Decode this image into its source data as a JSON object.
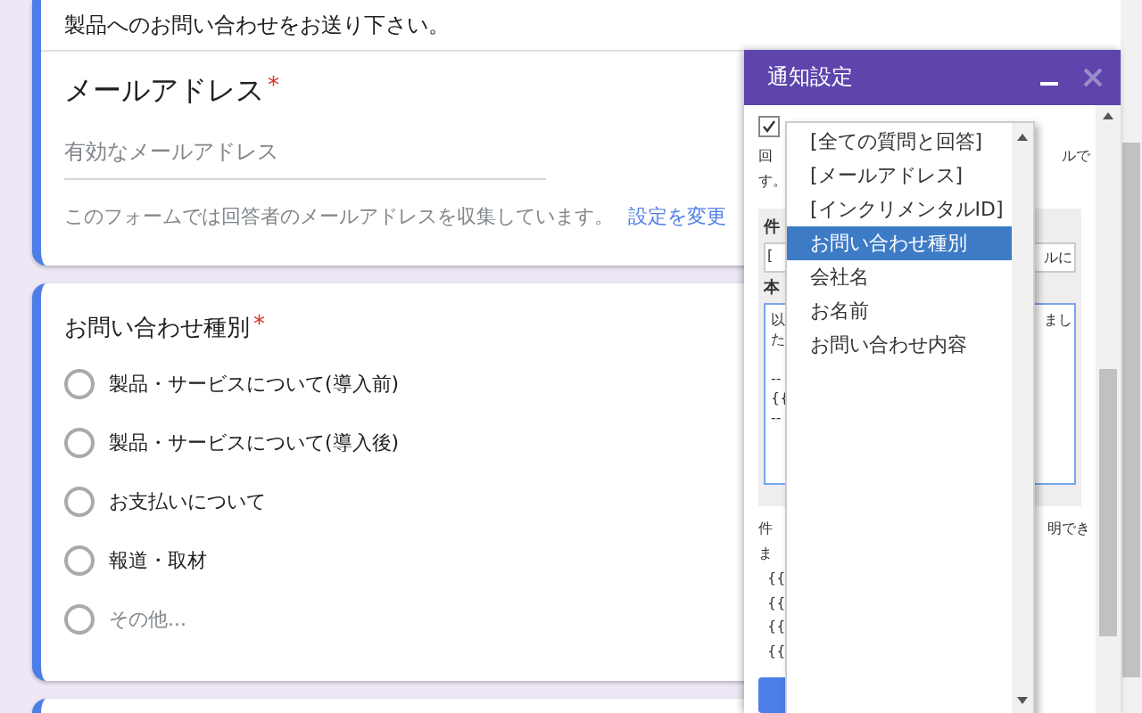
{
  "form": {
    "description": "製品へのお問い合わせをお送り下さい。",
    "email_question": {
      "title": "メールアドレス",
      "required_mark": "*",
      "placeholder": "有効なメールアドレス",
      "note": "このフォームでは回答者のメールアドレスを収集しています。",
      "link": "設定を変更"
    },
    "choice_question": {
      "title": "お問い合わせ種別",
      "required_mark": "*",
      "options": [
        {
          "label": "製品・サービスについて(導入前)",
          "kind": "option",
          "selected": false
        },
        {
          "label": "製品・サービスについて(導入後)",
          "kind": "option",
          "selected": false
        },
        {
          "label": "お支払いについて",
          "kind": "option",
          "selected": false
        },
        {
          "label": "報道・取材",
          "kind": "option",
          "selected": false
        },
        {
          "label": "その他...",
          "kind": "other",
          "selected": false
        }
      ]
    }
  },
  "panel": {
    "title": "通知設定",
    "enabled": {
      "checked": true
    },
    "intro_lines": [
      {
        "left": "回",
        "right": "ルで"
      },
      {
        "left": "す。"
      }
    ],
    "subject": {
      "label": "件",
      "value_start": "[",
      "value_end": "ルに"
    },
    "body": {
      "label": "本",
      "paragraphs": [
        [
          {
            "left": "以",
            "right": "まし"
          },
          {
            "left": "た"
          }
        ],
        [
          {
            "left": "--"
          },
          {
            "left": "{{"
          },
          {
            "left": "--"
          }
        ]
      ]
    },
    "help_lines": [
      {
        "left": "件",
        "right": "明でき"
      },
      {
        "left": "ま"
      }
    ],
    "placeholders": [
      "{{",
      "{{",
      "{{",
      "{{"
    ]
  },
  "dropdown": {
    "items": [
      {
        "label": "[全ての質問と回答]",
        "selected": false
      },
      {
        "label": "[メールアドレス]",
        "selected": false
      },
      {
        "label": "[インクリメンタルID]",
        "selected": false
      },
      {
        "label": "お問い合わせ種別",
        "selected": true
      },
      {
        "label": "会社名",
        "selected": false
      },
      {
        "label": "お名前",
        "selected": false
      },
      {
        "label": "お問い合わせ内容",
        "selected": false
      }
    ]
  }
}
